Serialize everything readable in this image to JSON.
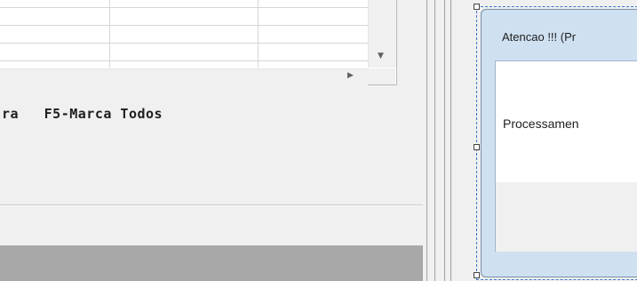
{
  "hotkey_bar": {
    "text": "ra   F5-Marca Todos"
  },
  "grid": {
    "scroll_down_icon": "triangle-down",
    "scroll_right_icon": "triangle-right"
  },
  "dialog": {
    "title": "Atencao !!! (Pr",
    "message": "Processamen"
  },
  "colors": {
    "status_bar": "#a8a8a8",
    "dialog_frame": "#cfe0f1",
    "selection_border": "#3c78c8"
  }
}
